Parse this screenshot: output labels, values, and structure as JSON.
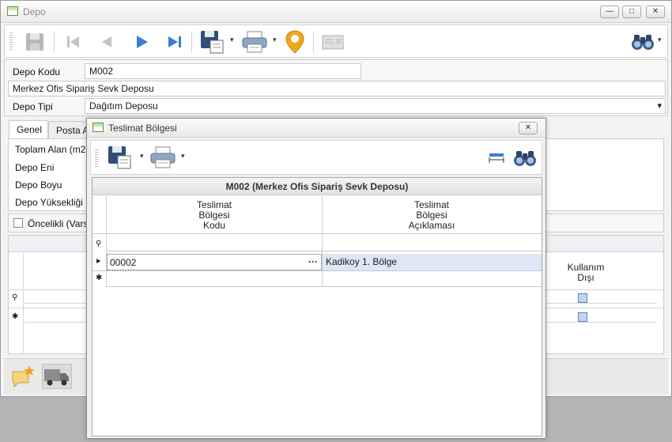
{
  "window": {
    "title": "Depo",
    "minimize_glyph": "—",
    "maximize_glyph": "□",
    "close_glyph": "✕"
  },
  "toolbar": {
    "icons": [
      "save-icon",
      "first-record-icon",
      "previous-record-icon",
      "next-record-icon",
      "last-record-icon",
      "save-as-icon",
      "print-icon",
      "location-pin-icon",
      "card-icon",
      "binoculars-search-icon"
    ],
    "dropdown_glyph": "▾"
  },
  "form": {
    "depo_kodu_label": "Depo Kodu",
    "depo_kodu_value": "M002",
    "depo_adi_value": "Merkez Ofis Sipariş Sevk Deposu",
    "depo_tipi_label": "Depo Tipi",
    "depo_tipi_value": "Dağıtım Deposu",
    "dropdown_arrow": "▾"
  },
  "tabs": [
    {
      "label": "Genel",
      "active": true
    },
    {
      "label": "Posta Ad"
    }
  ],
  "genel": {
    "fields": [
      {
        "label": "Toplam Alan (m2)"
      },
      {
        "label": "Depo Eni"
      },
      {
        "label": "Depo Boyu"
      },
      {
        "label": "Depo Yüksekliği"
      }
    ],
    "oncelikli_label": "Öncelikli (Varsa"
  },
  "bg_grid": {
    "column_header": "Kullanım\nDışı",
    "filter_row_glyph": "⚲",
    "new_row_glyph": "✱"
  },
  "bottom_icons": [
    "new-note-icon",
    "truck-icon"
  ],
  "dialog": {
    "title": "Teslimat Bölgesi",
    "close_glyph": "✕",
    "toolbar_icons": [
      "save-as-icon",
      "print-icon",
      "column-width-icon",
      "binoculars-search-icon"
    ],
    "grid_caption": "M002 (Merkez Ofis Sipariş Sevk Deposu)",
    "columns": [
      {
        "header": "Teslimat\nBölgesi\nKodu"
      },
      {
        "header": "Teslimat\nBölgesi\nAçıklaması"
      }
    ],
    "rows": [
      {
        "kod": "00002",
        "aciklama": "Kadikoy 1. Bölge",
        "ellipsis": "···"
      }
    ],
    "row_indicator_glyph": "▸",
    "filter_row_glyph": "⚲",
    "new_row_glyph": "✱"
  },
  "colors": {
    "accent_blue": "#3b7fd0",
    "selection": "#dde8f6",
    "titlebar_text": "#8a8a8a"
  }
}
